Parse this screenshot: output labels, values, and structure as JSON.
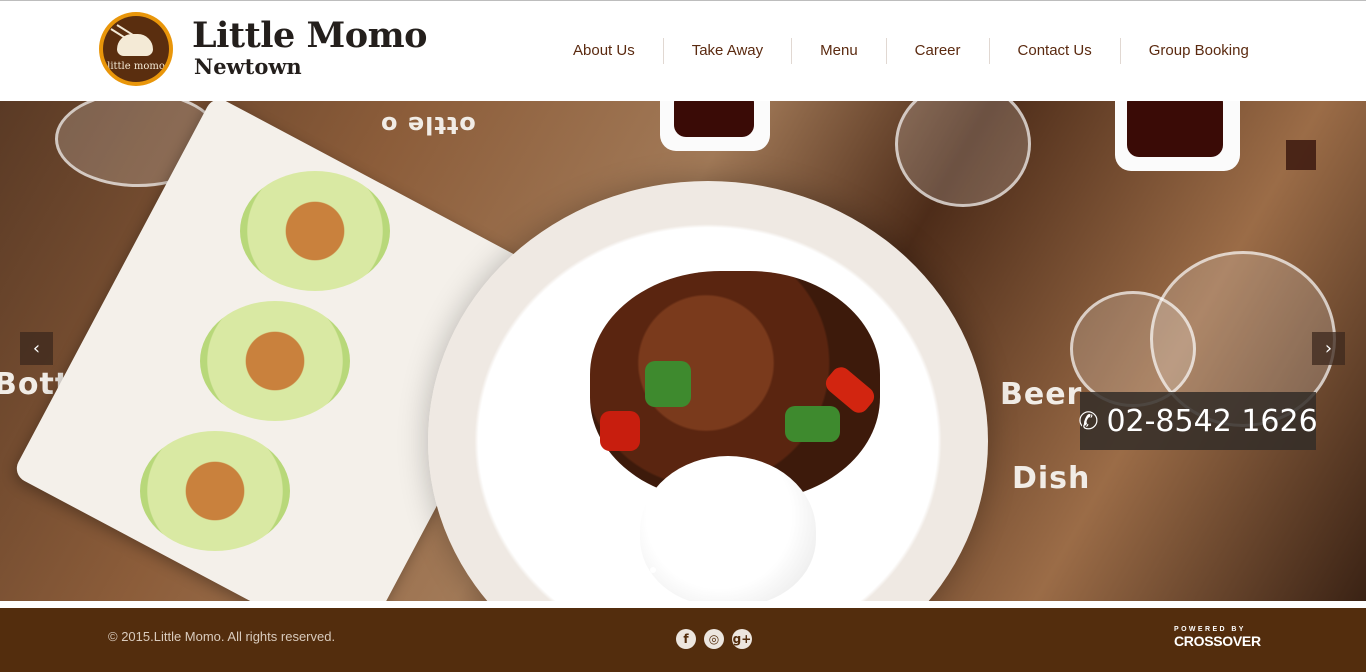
{
  "header": {
    "logo_text": "little momo",
    "brand_name": "Little Momo",
    "brand_sub": "Newtown"
  },
  "nav": {
    "items": [
      {
        "label": "About Us"
      },
      {
        "label": "Take Away"
      },
      {
        "label": "Menu"
      },
      {
        "label": "Career"
      },
      {
        "label": "Contact Us"
      },
      {
        "label": "Group Booking"
      }
    ]
  },
  "hero": {
    "phone_icon": "phone-icon",
    "phone_number": "02-8542 1626",
    "prev_icon": "chevron-left-icon",
    "next_icon": "chevron-right-icon",
    "prev_glyph": "‹",
    "next_glyph": "›",
    "slide_count": 6,
    "active_slide": 1,
    "photo_text": [
      "Bottle",
      "Beer",
      "Dish",
      "ottle o"
    ]
  },
  "footer": {
    "copyright": "© 2015.Little Momo. All rights reserved.",
    "social": [
      {
        "icon": "facebook-icon",
        "glyph": "f"
      },
      {
        "icon": "instagram-icon",
        "glyph": "◎"
      },
      {
        "icon": "google-plus-icon",
        "glyph": "g+"
      }
    ],
    "powered_by": "POWERED BY",
    "powered_brand": "CROSSOVER"
  },
  "colors": {
    "brand_brown": "#532d0d",
    "nav_text": "#5b2a10",
    "logo_ring": "#e9960a"
  }
}
